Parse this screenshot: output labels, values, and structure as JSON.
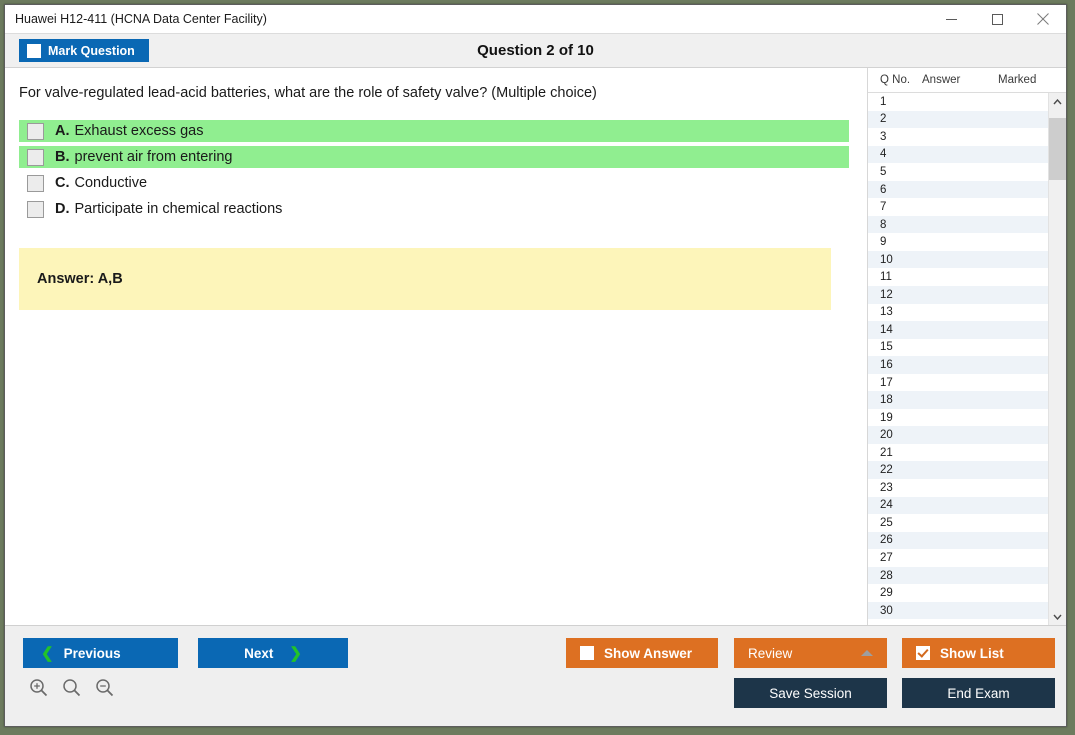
{
  "window": {
    "title": "Huawei H12-411 (HCNA Data Center Facility)",
    "minimize_label": "minimize",
    "maximize_label": "maximize",
    "close_label": "close"
  },
  "header": {
    "mark_question_label": "Mark Question",
    "mark_question_checked": false,
    "question_title": "Question 2 of 10"
  },
  "question": {
    "text": "For valve-regulated lead-acid batteries, what are the role of safety valve? (Multiple choice)",
    "options": [
      {
        "letter": "A.",
        "text": "Exhaust excess gas",
        "correct": true,
        "checked": false
      },
      {
        "letter": "B.",
        "text": "prevent air from entering",
        "correct": true,
        "checked": false
      },
      {
        "letter": "C.",
        "text": "Conductive",
        "correct": false,
        "checked": false
      },
      {
        "letter": "D.",
        "text": "Participate in chemical reactions",
        "correct": false,
        "checked": false
      }
    ],
    "answer_label": "Answer: A,B"
  },
  "question_list": {
    "columns": [
      "Q No.",
      "Answer",
      "Marked"
    ],
    "rows": [
      {
        "no": "1",
        "answer": "",
        "marked": ""
      },
      {
        "no": "2",
        "answer": "",
        "marked": ""
      },
      {
        "no": "3",
        "answer": "",
        "marked": ""
      },
      {
        "no": "4",
        "answer": "",
        "marked": ""
      },
      {
        "no": "5",
        "answer": "",
        "marked": ""
      },
      {
        "no": "6",
        "answer": "",
        "marked": ""
      },
      {
        "no": "7",
        "answer": "",
        "marked": ""
      },
      {
        "no": "8",
        "answer": "",
        "marked": ""
      },
      {
        "no": "9",
        "answer": "",
        "marked": ""
      },
      {
        "no": "10",
        "answer": "",
        "marked": ""
      },
      {
        "no": "11",
        "answer": "",
        "marked": ""
      },
      {
        "no": "12",
        "answer": "",
        "marked": ""
      },
      {
        "no": "13",
        "answer": "",
        "marked": ""
      },
      {
        "no": "14",
        "answer": "",
        "marked": ""
      },
      {
        "no": "15",
        "answer": "",
        "marked": ""
      },
      {
        "no": "16",
        "answer": "",
        "marked": ""
      },
      {
        "no": "17",
        "answer": "",
        "marked": ""
      },
      {
        "no": "18",
        "answer": "",
        "marked": ""
      },
      {
        "no": "19",
        "answer": "",
        "marked": ""
      },
      {
        "no": "20",
        "answer": "",
        "marked": ""
      },
      {
        "no": "21",
        "answer": "",
        "marked": ""
      },
      {
        "no": "22",
        "answer": "",
        "marked": ""
      },
      {
        "no": "23",
        "answer": "",
        "marked": ""
      },
      {
        "no": "24",
        "answer": "",
        "marked": ""
      },
      {
        "no": "25",
        "answer": "",
        "marked": ""
      },
      {
        "no": "26",
        "answer": "",
        "marked": ""
      },
      {
        "no": "27",
        "answer": "",
        "marked": ""
      },
      {
        "no": "28",
        "answer": "",
        "marked": ""
      },
      {
        "no": "29",
        "answer": "",
        "marked": ""
      },
      {
        "no": "30",
        "answer": "",
        "marked": ""
      }
    ]
  },
  "toolbar": {
    "previous_label": "Previous",
    "next_label": "Next",
    "show_answer_label": "Show Answer",
    "show_answer_checked": false,
    "review_label": "Review",
    "show_list_label": "Show List",
    "show_list_checked": true,
    "save_session_label": "Save Session",
    "end_exam_label": "End Exam",
    "zoom_in_icon": "zoom-in-icon",
    "zoom_reset_icon": "zoom-reset-icon",
    "zoom_out_icon": "zoom-out-icon"
  },
  "colors": {
    "primary_blue": "#0a68b4",
    "orange": "#dd7022",
    "navy": "#1d3549",
    "correct_green": "#90ee90",
    "answer_yellow": "#fdf5ba",
    "chevron_green": "#22c32a"
  }
}
